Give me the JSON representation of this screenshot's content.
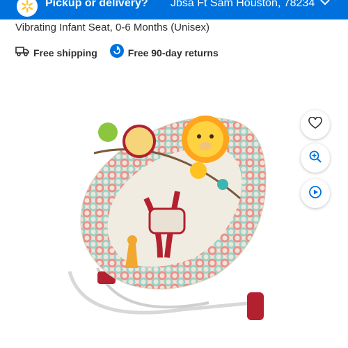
{
  "header": {
    "pickup_label": "Pickup or delivery?",
    "location": "Jbsa Ft Sam Houston, 78234"
  },
  "product": {
    "title": "Vibrating Infant Seat, 0-6 Months (Unisex)"
  },
  "badges": [
    {
      "icon": "truck-icon",
      "label": "Free shipping"
    },
    {
      "icon": "returns-icon",
      "label": "Free 90-day returns"
    }
  ],
  "actions": [
    {
      "icon": "heart-icon"
    },
    {
      "icon": "zoom-in-icon"
    },
    {
      "icon": "play-icon"
    }
  ],
  "colors": {
    "brand_blue": "#0071dc",
    "spark_yellow": "#ffc220"
  }
}
